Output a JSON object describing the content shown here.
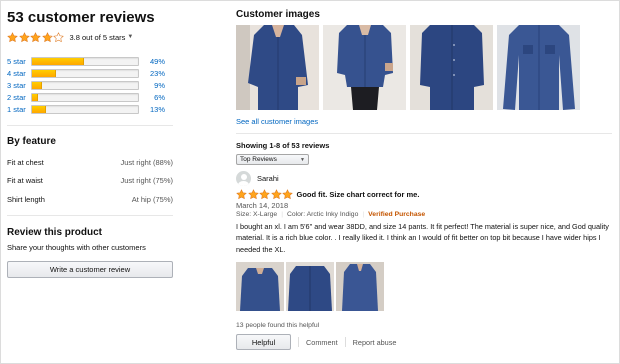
{
  "summary": {
    "title": "53 customer reviews",
    "rating_value": 3.8,
    "rating_text": "3.8 out of 5 stars",
    "histogram": [
      {
        "label": "5 star",
        "percent": 49,
        "percent_text": "49%"
      },
      {
        "label": "4 star",
        "percent": 23,
        "percent_text": "23%"
      },
      {
        "label": "3 star",
        "percent": 9,
        "percent_text": "9%"
      },
      {
        "label": "2 star",
        "percent": 6,
        "percent_text": "6%"
      },
      {
        "label": "1 star",
        "percent": 13,
        "percent_text": "13%"
      }
    ]
  },
  "by_feature": {
    "title": "By feature",
    "items": [
      {
        "name": "Fit at chest",
        "value": "Just right  (88%)"
      },
      {
        "name": "Fit at waist",
        "value": "Just right  (75%)"
      },
      {
        "name": "Shirt length",
        "value": "At hip  (75%)"
      }
    ]
  },
  "review_product": {
    "title": "Review this product",
    "subtitle": "Share your thoughts with other customers",
    "button_label": "Write a customer review"
  },
  "customer_images": {
    "title": "Customer images",
    "see_all": "See all customer images"
  },
  "reviews": {
    "showing": "Showing 1-8 of 53 reviews",
    "sort_selected": "Top Reviews"
  },
  "review": {
    "username": "Sarahi",
    "rating_value": 5,
    "title": "Good fit. Size chart correct for me.",
    "date": "March 14, 2018",
    "size": "Size: X-Large",
    "color": "Color: Arctic Inky Indigo",
    "verified": "Verified Purchase",
    "body": "I bought an xl. I am 5'6\" and wear 38DD, and size 14 pants. It fit perfect! The material is super nice, and God quality material. It is a rich blue color. . I really liked it. I think an I would of fit better on top bit because I have wider hips I needed the XL.",
    "helpful_count": "13 people found this helpful",
    "helpful_button": "Helpful",
    "comment_link": "Comment",
    "report_link": "Report abuse"
  },
  "colors": {
    "link": "#0066c0",
    "star": "#ffa41c",
    "bar": "#ffa700",
    "verified": "#c45500",
    "shirt": "#2f4a86"
  }
}
